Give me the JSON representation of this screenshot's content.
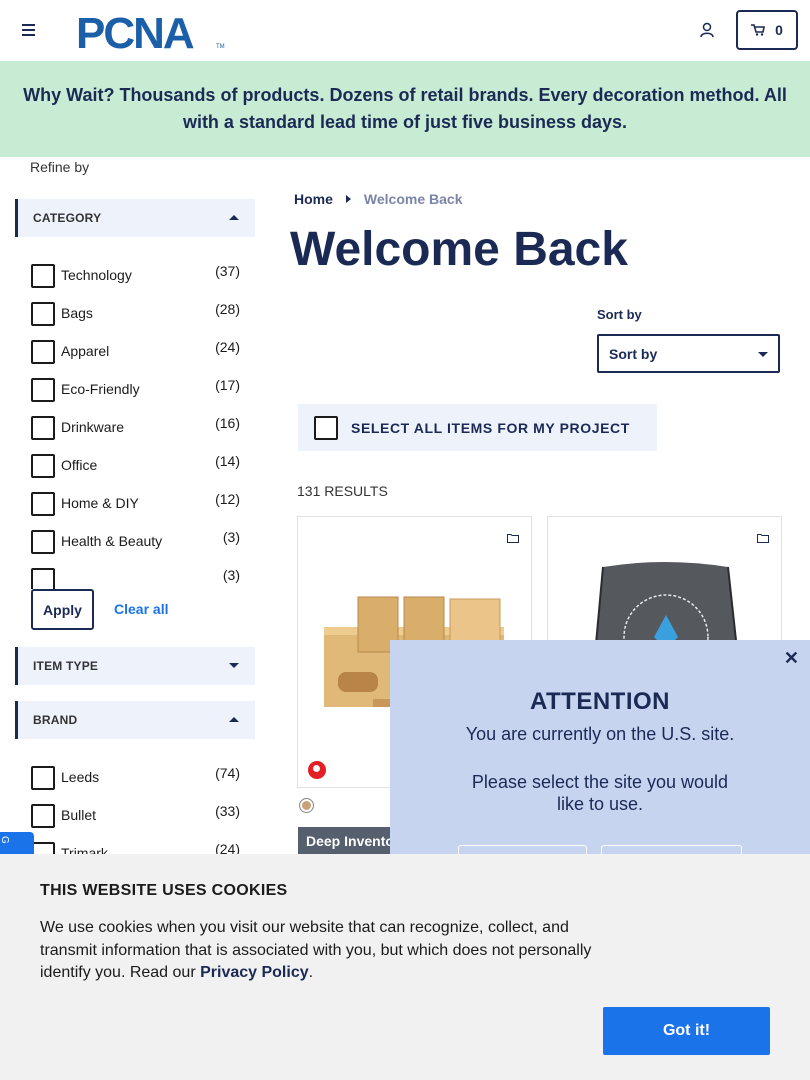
{
  "header": {
    "logo_text": "PCNA",
    "cart_count": "0"
  },
  "banner": {
    "text": "Why Wait? Thousands of products. Dozens of retail brands. Every decoration method. All with a standard lead time of just five business days."
  },
  "sidebar": {
    "refine_label": "Refine by",
    "category": {
      "title": "CATEGORY",
      "items": [
        {
          "label": "Technology",
          "count": "(37)"
        },
        {
          "label": "Bags",
          "count": "(28)"
        },
        {
          "label": "Apparel",
          "count": "(24)"
        },
        {
          "label": "Eco-Friendly",
          "count": "(17)"
        },
        {
          "label": "Drinkware",
          "count": "(16)"
        },
        {
          "label": "Office",
          "count": "(14)"
        },
        {
          "label": "Home & DIY",
          "count": "(12)"
        },
        {
          "label": "Health & Beauty",
          "count": "(3)"
        },
        {
          "label": "",
          "count": "(3)"
        }
      ]
    },
    "apply_label": "Apply",
    "clear_label": "Clear all",
    "item_type": {
      "title": "ITEM TYPE"
    },
    "brand": {
      "title": "BRAND",
      "items": [
        {
          "label": "Leeds",
          "count": "(74)"
        },
        {
          "label": "Bullet",
          "count": "(33)"
        },
        {
          "label": "Trimark",
          "count": "(24)"
        }
      ]
    }
  },
  "main": {
    "breadcrumb": {
      "home": "Home",
      "current": "Welcome Back"
    },
    "title": "Welcome Back",
    "sort_label": "Sort by",
    "sort_value": "Sort by",
    "select_all_label": "SELECT ALL ITEMS FOR MY PROJECT",
    "results_label": "131 RESULTS",
    "badge_label": "Deep Inventory"
  },
  "attention": {
    "title": "ATTENTION",
    "line1": "You are currently on the U.S. site.",
    "line2": "Please select the site you would like to use."
  },
  "cookie": {
    "title": "THIS WEBSITE USES COOKIES",
    "body": "We use cookies when you visit our website that can recognize, collect, and transmit information that is associated with you, but which does not personally identify you. Read our ",
    "link": "Privacy Policy",
    "end": ".",
    "button": "Got it!"
  },
  "colors": {
    "navy": "#1b2a55",
    "banner_green": "#c8ecd3",
    "accent_blue": "#1a73e8",
    "modal_bg": "#c6d4f0"
  }
}
